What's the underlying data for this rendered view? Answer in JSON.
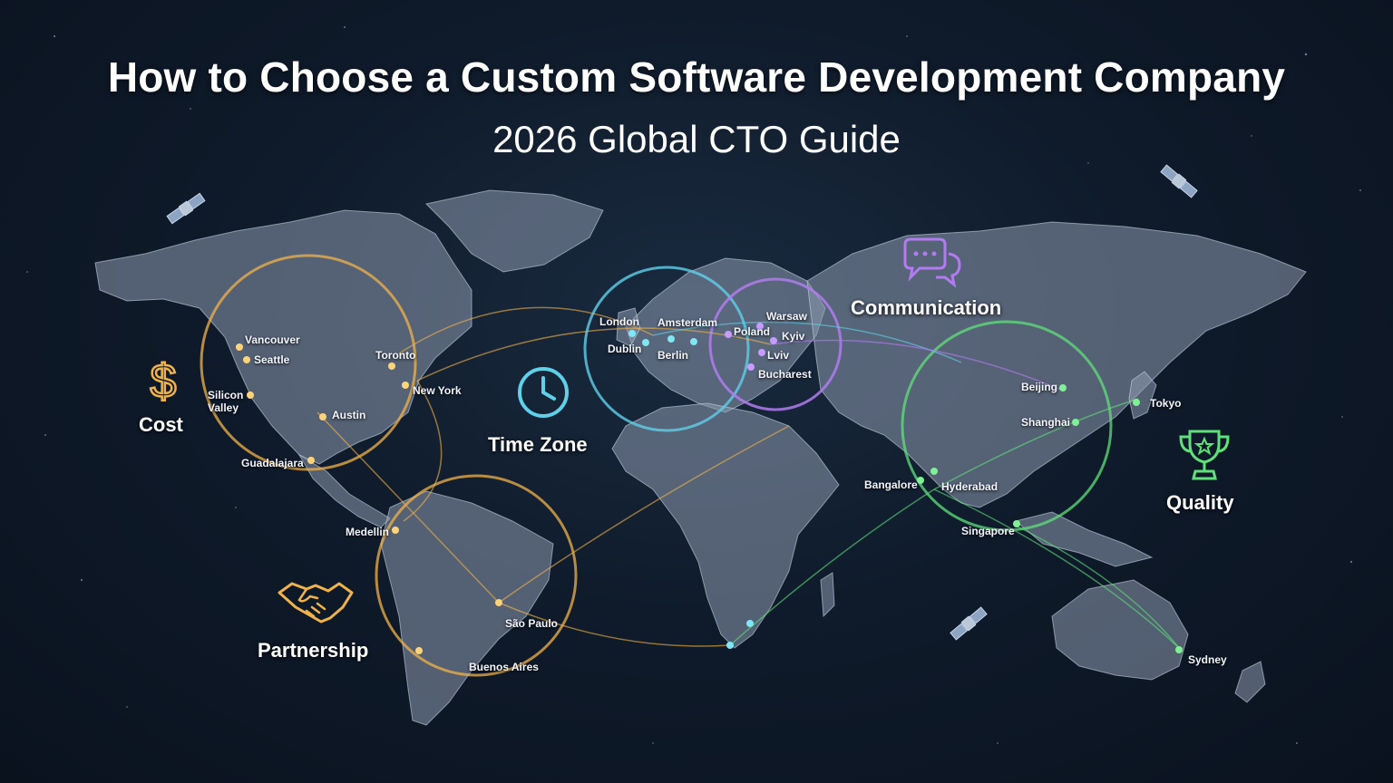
{
  "header": {
    "title": "How to Choose a Custom Software Development Company",
    "subtitle": "2026 Global CTO Guide"
  },
  "factors": [
    {
      "id": "cost",
      "label": "Cost",
      "icon": "dollar-icon",
      "color": "#f0b24a"
    },
    {
      "id": "time-zone",
      "label": "Time Zone",
      "icon": "clock-icon",
      "color": "#5fd0e8"
    },
    {
      "id": "communication",
      "label": "Communication",
      "icon": "chat-bubbles-icon",
      "color": "#b27cf0"
    },
    {
      "id": "quality",
      "label": "Quality",
      "icon": "trophy-icon",
      "color": "#5fe07a"
    },
    {
      "id": "partnership",
      "label": "Partnership",
      "icon": "handshake-icon",
      "color": "#f0b24a"
    }
  ],
  "cities": {
    "vancouver": "Vancouver",
    "seattle": "Seattle",
    "silicon_valley": "Silicon\nValley",
    "austin": "Austin",
    "toronto": "Toronto",
    "new_york": "New York",
    "guadalajara": "Guadalajara",
    "medellin": "Medellin",
    "sao_paulo": "São Paulo",
    "buenos_aires": "Buenos Aires",
    "london": "London",
    "dublin": "Dublin",
    "amsterdam": "Amsterdam",
    "berlin": "Berlin",
    "poland": "Poland",
    "warsaw": "Warsaw",
    "kyiv": "Kyiv",
    "lviv": "Lviv",
    "bucharest": "Bucharest",
    "beijing": "Beijing",
    "shanghai": "Shanghai",
    "tokyo": "Tokyo",
    "bangalore": "Bangalore",
    "hyderabad": "Hyderabad",
    "singapore": "Singapore",
    "sydney": "Sydney"
  },
  "region_colors": {
    "americas": "#f0b24a",
    "west_europe": "#5fd0e8",
    "east_europe": "#b27cf0",
    "asia": "#5fe07a"
  },
  "decor_icons": [
    "satellite-icon",
    "satellite-icon",
    "satellite-icon"
  ]
}
